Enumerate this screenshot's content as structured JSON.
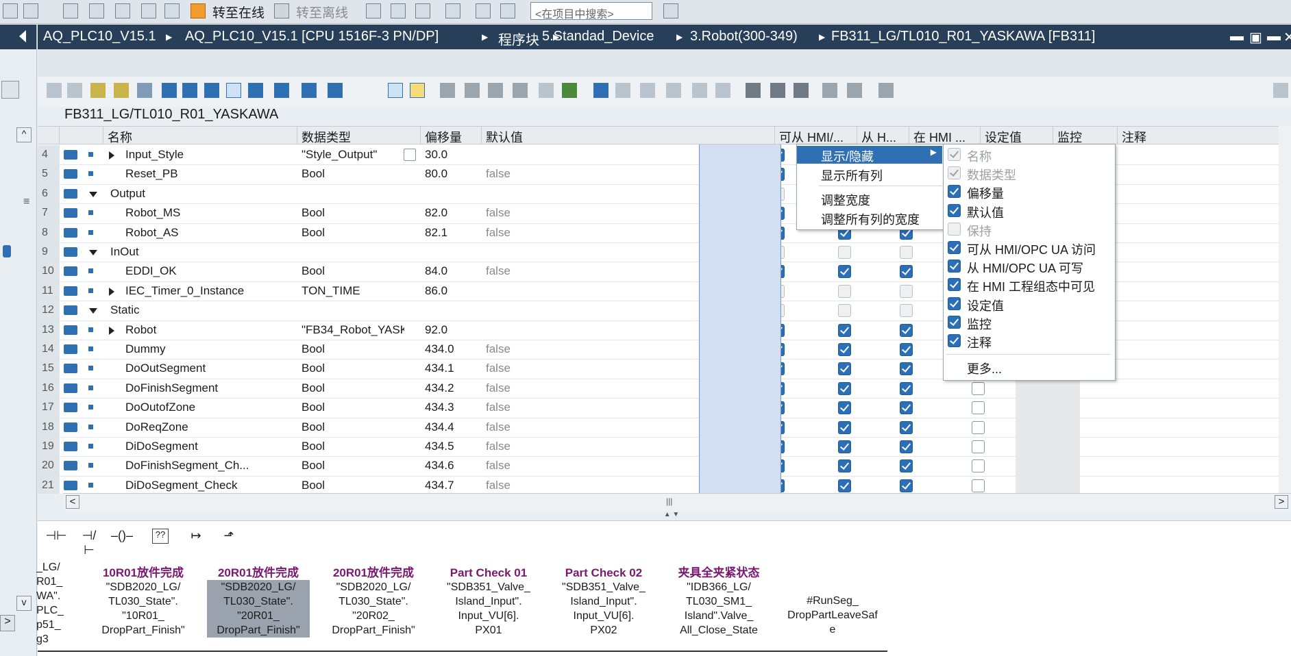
{
  "topbar": {
    "go_online": "转至在线",
    "go_offline": "转至离线",
    "search_placeholder": "<在项目中搜索>"
  },
  "breadcrumb": {
    "items": [
      "AQ_PLC10_V15.1",
      "AQ_PLC10_V15.1 [CPU 1516F-3 PN/DP]",
      "程序块",
      "5.Standad_Device",
      "3.Robot(300-349)",
      "FB311_LG/TL010_R01_YASKAWA [FB311]"
    ]
  },
  "block_title": "FB311_LG/TL010_R01_YASKAWA",
  "table": {
    "headers": {
      "name": "名称",
      "datatype": "数据类型",
      "offset": "偏移量",
      "default": "默认值",
      "hmi_access": "可从 HMI/...",
      "hmi_write": "从 H...",
      "hmi_visible": "在 HMI ...",
      "setpoint": "设定值",
      "monitor": "监控",
      "comment": "注释"
    },
    "rows": [
      {
        "num": "4",
        "name": "Input_Style",
        "type": "\"Style_Output\"",
        "offset": "30.0",
        "default": ""
      },
      {
        "num": "5",
        "name": "Reset_PB",
        "type": "Bool",
        "offset": "80.0",
        "default": "false"
      },
      {
        "num": "6",
        "name": "Output",
        "type": "",
        "offset": "",
        "default": ""
      },
      {
        "num": "7",
        "name": "Robot_MS",
        "type": "Bool",
        "offset": "82.0",
        "default": "false"
      },
      {
        "num": "8",
        "name": "Robot_AS",
        "type": "Bool",
        "offset": "82.1",
        "default": "false"
      },
      {
        "num": "9",
        "name": "InOut",
        "type": "",
        "offset": "",
        "default": ""
      },
      {
        "num": "10",
        "name": "EDDI_OK",
        "type": "Bool",
        "offset": "84.0",
        "default": "false"
      },
      {
        "num": "11",
        "name": "IEC_Timer_0_Instance",
        "type": "TON_TIME",
        "offset": "86.0",
        "default": ""
      },
      {
        "num": "12",
        "name": "Static",
        "type": "",
        "offset": "",
        "default": ""
      },
      {
        "num": "13",
        "name": "Robot",
        "type": "\"FB34_Robot_YASK...",
        "offset": "92.0",
        "default": ""
      },
      {
        "num": "14",
        "name": "Dummy",
        "type": "Bool",
        "offset": "434.0",
        "default": "false"
      },
      {
        "num": "15",
        "name": "DoOutSegment",
        "type": "Bool",
        "offset": "434.1",
        "default": "false"
      },
      {
        "num": "16",
        "name": "DoFinishSegment",
        "type": "Bool",
        "offset": "434.2",
        "default": "false"
      },
      {
        "num": "17",
        "name": "DoOutofZone",
        "type": "Bool",
        "offset": "434.3",
        "default": "false"
      },
      {
        "num": "18",
        "name": "DoReqZone",
        "type": "Bool",
        "offset": "434.4",
        "default": "false"
      },
      {
        "num": "19",
        "name": "DiDoSegment",
        "type": "Bool",
        "offset": "434.5",
        "default": "false"
      },
      {
        "num": "20",
        "name": "DoFinishSegment_Ch...",
        "type": "Bool",
        "offset": "434.6",
        "default": "false"
      },
      {
        "num": "21",
        "name": "DiDoSegment_Check",
        "type": "Bool",
        "offset": "434.7",
        "default": "false"
      }
    ]
  },
  "context_menu": {
    "show_hide": "显示/隐藏",
    "show_all_columns": "显示所有列",
    "adjust_width": "调整宽度",
    "adjust_all_widths": "调整所有列的宽度"
  },
  "submenu": {
    "items": [
      "名称",
      "数据类型",
      "偏移量",
      "默认值",
      "保持",
      "可从 HMI/OPC UA 访问",
      "从 HMI/OPC UA 可写",
      "在 HMI 工程组态中可见",
      "设定值",
      "监控",
      "注释"
    ],
    "more": "更多..."
  },
  "lad": {
    "operands": [
      {
        "title": "10R01放件完成",
        "lines": [
          "\"SDB2020_LG/",
          "TL030_State\".",
          "\"10R01_",
          "DropPart_Finish\""
        ]
      },
      {
        "title": "20R01放件完成",
        "lines": [
          "\"SDB2020_LG/",
          "TL030_State\".",
          "\"20R01_",
          "DropPart_Finish\""
        ]
      },
      {
        "title": "20R01放件完成",
        "lines": [
          "\"SDB2020_LG/",
          "TL030_State\".",
          "\"20R02_",
          "DropPart_Finish\""
        ]
      },
      {
        "title": "Part Check 01",
        "lines": [
          "\"SDB351_Valve_",
          "Island_Input\".",
          "Input_VU[6].",
          "PX01"
        ]
      },
      {
        "title": "Part Check 02",
        "lines": [
          "\"SDB351_Valve_",
          "Island_Input\".",
          "Input_VU[6].",
          "PX02"
        ]
      },
      {
        "title": "夹具全夹紧状态",
        "lines": [
          "\"IDB366_LG/",
          "TL030_SM1_",
          "Island\".Valve_",
          "All_Close_State"
        ]
      },
      {
        "title": "",
        "lines": [
          "#RunSeg_",
          "DropPartLeaveSaf",
          "e"
        ]
      }
    ],
    "left_cut": [
      "_LG/",
      "R01_",
      "WA\".",
      "PLC_",
      "p51_",
      "g3"
    ]
  }
}
